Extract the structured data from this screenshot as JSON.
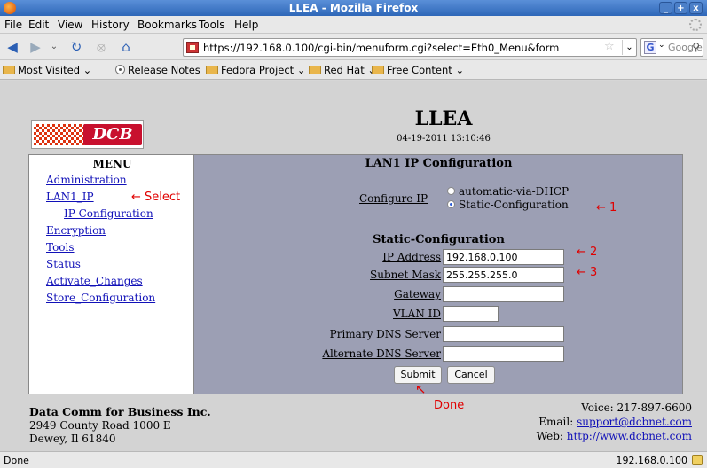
{
  "window": {
    "title": "LLEA - Mozilla Firefox",
    "buttons": [
      "_",
      "+",
      "x"
    ]
  },
  "menubar": {
    "items": [
      "File",
      "Edit",
      "View",
      "History",
      "Bookmarks",
      "Tools",
      "Help"
    ]
  },
  "navbar": {
    "url": "https://192.168.0.100/cgi-bin/menuform.cgi?select=Eth0_Menu&form",
    "search_placeholder": "Google",
    "icons": [
      "back-icon",
      "forward-icon",
      "reload-icon",
      "stop-icon",
      "home-icon"
    ]
  },
  "bookmarks": {
    "items": [
      "Most Visited",
      "Release Notes",
      "Fedora Project",
      "Red Hat",
      "Free Content"
    ]
  },
  "page": {
    "title": "LLEA",
    "datetime": "04-19-2011 13:10:46",
    "logo_text": "DCB"
  },
  "sidebar": {
    "heading": "MENU",
    "items": [
      "Administration",
      "LAN1_IP",
      "IP Configuration",
      "Encryption",
      "Tools",
      "Status",
      "Activate_Changes",
      "Store_Configuration"
    ]
  },
  "main": {
    "title": "LAN1 IP Configuration",
    "configure_label": "Configure IP",
    "options": [
      "automatic-via-DHCP",
      "Static-Configuration"
    ],
    "selected_option": "Static-Configuration",
    "static_title": "Static-Configuration",
    "fields": [
      {
        "label": "IP Address",
        "value": "192.168.0.100"
      },
      {
        "label": "Subnet Mask",
        "value": "255.255.255.0"
      },
      {
        "label": "Gateway",
        "value": ""
      },
      {
        "label": "VLAN ID",
        "value": ""
      },
      {
        "label": "Primary DNS Server",
        "value": ""
      },
      {
        "label": "Alternate DNS Server",
        "value": ""
      }
    ],
    "submit": "Submit",
    "cancel": "Cancel"
  },
  "footer": {
    "company": "Data Comm for Business Inc.",
    "address1": "2949 County Road 1000 E",
    "address2": "Dewey, Il 61840",
    "voice": "Voice: 217-897-6600",
    "email_label": "Email: ",
    "email": "support@dcbnet.com",
    "web_label": "Web: ",
    "web": "http://www.dcbnet.com"
  },
  "annotations": {
    "select": "Select",
    "one": "1",
    "two": "2",
    "three": "3",
    "done": "Done"
  },
  "statusbar": {
    "text": "Done",
    "host": "192.168.0.100"
  },
  "colors": {
    "titlebar": "#2e67b8",
    "sidebar_bg": "#ffffff",
    "main_bg": "#9c9fb4",
    "link": "#1010b8",
    "annotation": "#e00000"
  }
}
